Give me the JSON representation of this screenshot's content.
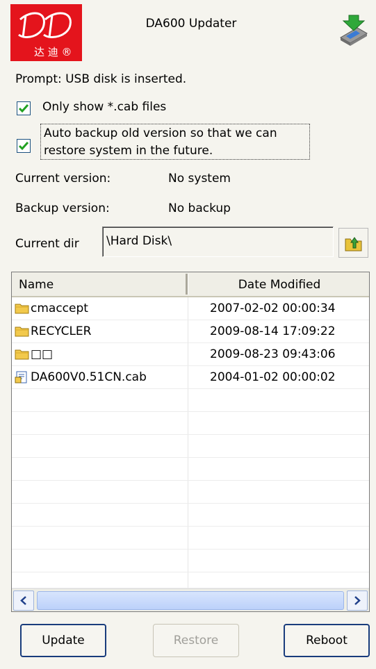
{
  "app": {
    "title": "DA600 Updater",
    "logo_text": "达 迪 ®"
  },
  "prompt": "Prompt: USB disk is inserted.",
  "options": {
    "only_cab": {
      "label": "Only show *.cab files",
      "checked": true
    },
    "auto_backup": {
      "label": "Auto backup old version so that we can restore system in the future.",
      "checked": true
    }
  },
  "versions": {
    "current_label": "Current version:",
    "current_value": "No system",
    "backup_label": "Backup version:",
    "backup_value": "No backup"
  },
  "directory": {
    "label": "Current dir",
    "value": "\\Hard Disk\\"
  },
  "file_list": {
    "columns": [
      "Name",
      "Date Modified"
    ],
    "rows": [
      {
        "name": "cmaccept",
        "date": "2007-02-02 00:00:34",
        "icon": "folder-icon"
      },
      {
        "name": "RECYCLER",
        "date": "2009-08-14 17:09:22",
        "icon": "folder-icon"
      },
      {
        "name": "□□",
        "date": "2009-08-23 09:43:06",
        "icon": "folder-icon"
      },
      {
        "name": "DA600V0.51CN.cab",
        "date": "2004-01-02 00:00:02",
        "icon": "cab-file-icon"
      }
    ]
  },
  "buttons": {
    "update": "Update",
    "restore": "Restore",
    "reboot": "Reboot"
  },
  "colors": {
    "logo_red": "#e4141c",
    "check_green": "#21a121",
    "button_border": "#193c7c"
  }
}
